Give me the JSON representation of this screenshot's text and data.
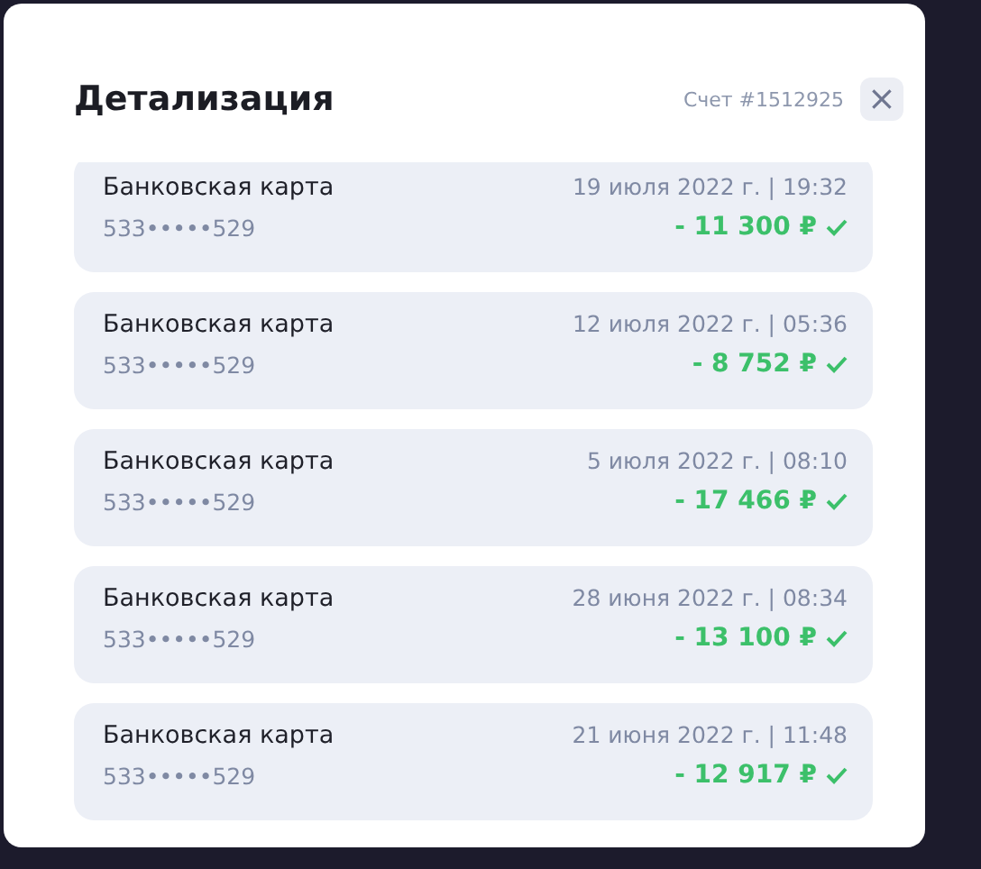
{
  "dialog": {
    "title": "Детализация",
    "account": "Счет #1512925",
    "close": "×"
  },
  "transactions": [
    {
      "method": "Банковская карта",
      "card": "533•••••529",
      "date": "19 июля 2022 г. | 19:32",
      "amount": "- 11 300 ₽",
      "confirmed": true
    },
    {
      "method": "Банковская карта",
      "card": "533•••••529",
      "date": "12 июля 2022 г. | 05:36",
      "amount": "- 8 752 ₽",
      "confirmed": true
    },
    {
      "method": "Банковская карта",
      "card": "533•••••529",
      "date": "5 июля 2022 г. | 08:10",
      "amount": "- 17 466 ₽",
      "confirmed": true
    },
    {
      "method": "Банковская карта",
      "card": "533•••••529",
      "date": "28 июня 2022 г. | 08:34",
      "amount": "- 13 100 ₽",
      "confirmed": true
    },
    {
      "method": "Банковская карта",
      "card": "533•••••529",
      "date": "21 июня 2022 г. | 11:48",
      "amount": "- 12 917 ₽",
      "confirmed": true
    }
  ]
}
